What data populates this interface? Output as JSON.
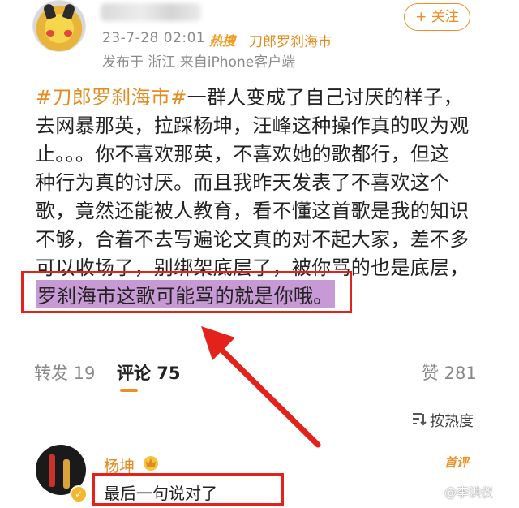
{
  "post": {
    "follow_label": "+ 关注",
    "time": "23-7-28 02:01",
    "hot_badge": "热搜",
    "topic": "刀郎罗刹海市",
    "meta": "发布于 浙江  来自iPhone客户端",
    "hashtag": "#刀郎罗刹海市#",
    "lines": [
      "一群人变成了自己讨厌的样子，",
      "去网暴那英，拉踩杨坤，汪峰这种操作真的叹为观",
      "止。。。你不喜欢那英，不喜欢她的歌都行，但这",
      "种行为真的讨厌。而且我昨天发表了不喜欢这个",
      "歌，竟然还能被人教育，看不懂这首歌是我的知识",
      "不够，合着不去写遍论文真的对不起大家，差不多",
      "可以收场了，别绑架底层了，被你骂的也是底层，"
    ],
    "highlight": "罗刹海市这歌可能骂的就是你哦。"
  },
  "actions": {
    "repost": "转发 19",
    "comment": "评论 75",
    "like": "赞 281",
    "sort": "按热度"
  },
  "comment": {
    "name": "杨坤",
    "badge": "首评",
    "text": "最后一句说对了"
  },
  "watermark": "@李洪仪",
  "colors": {
    "accent": "#f08d24",
    "annotation": "#e3221b",
    "highlight": "#c79ad6"
  }
}
